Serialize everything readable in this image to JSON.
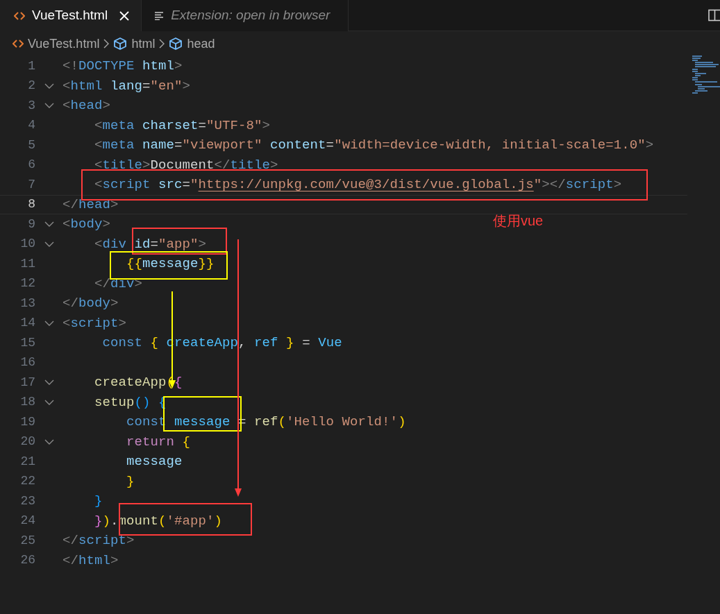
{
  "tabs": [
    {
      "label": "VueTest.html",
      "selected": true,
      "kind": "file"
    },
    {
      "label": "Extension: open in browser",
      "selected": false,
      "kind": "preview"
    }
  ],
  "breadcrumbs": [
    {
      "label": "VueTest.html",
      "kind": "file"
    },
    {
      "label": "html",
      "kind": "element"
    },
    {
      "label": "head",
      "kind": "element"
    }
  ],
  "lines": [
    {
      "number": "1",
      "foldable": false,
      "current": false,
      "tokens": [
        {
          "kind": "punct",
          "text": "<!"
        },
        {
          "kind": "tag",
          "text": "DOCTYPE"
        },
        {
          "kind": "attr",
          "text": " html"
        },
        {
          "kind": "punct",
          "text": ">"
        }
      ]
    },
    {
      "number": "2",
      "foldable": true,
      "current": false,
      "tokens": [
        {
          "kind": "punct",
          "text": "<"
        },
        {
          "kind": "tag",
          "text": "html"
        },
        {
          "kind": "attr",
          "text": " lang"
        },
        {
          "kind": "plain",
          "text": "="
        },
        {
          "kind": "string",
          "text": "\"en\""
        },
        {
          "kind": "punct",
          "text": ">"
        }
      ]
    },
    {
      "number": "3",
      "foldable": true,
      "current": false,
      "tokens": [
        {
          "kind": "punct",
          "text": "<"
        },
        {
          "kind": "tag",
          "text": "head"
        },
        {
          "kind": "punct",
          "text": ">"
        }
      ]
    },
    {
      "number": "4",
      "foldable": false,
      "current": false,
      "tokens": [
        {
          "kind": "punct",
          "text": "    <"
        },
        {
          "kind": "tag",
          "text": "meta"
        },
        {
          "kind": "attr",
          "text": " charset"
        },
        {
          "kind": "plain",
          "text": "="
        },
        {
          "kind": "string",
          "text": "\"UTF-8\""
        },
        {
          "kind": "punct",
          "text": ">"
        }
      ]
    },
    {
      "number": "5",
      "foldable": false,
      "current": false,
      "tokens": [
        {
          "kind": "punct",
          "text": "    <"
        },
        {
          "kind": "tag",
          "text": "meta"
        },
        {
          "kind": "attr",
          "text": " name"
        },
        {
          "kind": "plain",
          "text": "="
        },
        {
          "kind": "string",
          "text": "\"viewport\""
        },
        {
          "kind": "attr",
          "text": " content"
        },
        {
          "kind": "plain",
          "text": "="
        },
        {
          "kind": "string",
          "text": "\"width=device-width, initial-scale=1.0\""
        },
        {
          "kind": "punct",
          "text": ">"
        }
      ]
    },
    {
      "number": "6",
      "foldable": false,
      "current": false,
      "tokens": [
        {
          "kind": "punct",
          "text": "    <"
        },
        {
          "kind": "tag",
          "text": "title"
        },
        {
          "kind": "punct",
          "text": ">"
        },
        {
          "kind": "plain",
          "text": "Document"
        },
        {
          "kind": "punct",
          "text": "</"
        },
        {
          "kind": "tag",
          "text": "title"
        },
        {
          "kind": "punct",
          "text": ">"
        }
      ]
    },
    {
      "number": "7",
      "foldable": false,
      "current": false,
      "tokens": [
        {
          "kind": "punct",
          "text": "    <"
        },
        {
          "kind": "tag",
          "text": "script"
        },
        {
          "kind": "attr",
          "text": " src"
        },
        {
          "kind": "plain",
          "text": "="
        },
        {
          "kind": "string",
          "text": "\""
        },
        {
          "kind": "url",
          "text": "https://unpkg.com/vue@3/dist/vue.global.js"
        },
        {
          "kind": "string",
          "text": "\""
        },
        {
          "kind": "punct",
          "text": "></"
        },
        {
          "kind": "tag",
          "text": "script"
        },
        {
          "kind": "punct",
          "text": ">"
        }
      ]
    },
    {
      "number": "8",
      "foldable": false,
      "current": true,
      "tokens": [
        {
          "kind": "punct",
          "text": "</"
        },
        {
          "kind": "tag",
          "text": "head"
        },
        {
          "kind": "punct",
          "text": ">"
        }
      ]
    },
    {
      "number": "9",
      "foldable": true,
      "current": false,
      "tokens": [
        {
          "kind": "punct",
          "text": "<"
        },
        {
          "kind": "tag",
          "text": "body"
        },
        {
          "kind": "punct",
          "text": ">"
        }
      ]
    },
    {
      "number": "10",
      "foldable": true,
      "current": false,
      "tokens": [
        {
          "kind": "punct",
          "text": "    <"
        },
        {
          "kind": "tag",
          "text": "div"
        },
        {
          "kind": "attr",
          "text": " id"
        },
        {
          "kind": "plain",
          "text": "="
        },
        {
          "kind": "string",
          "text": "\"app\""
        },
        {
          "kind": "punct",
          "text": ">"
        }
      ]
    },
    {
      "number": "11",
      "foldable": false,
      "current": false,
      "tokens": [
        {
          "kind": "gold",
          "text": "        {{"
        },
        {
          "kind": "attr",
          "text": "message"
        },
        {
          "kind": "gold",
          "text": "}}"
        }
      ]
    },
    {
      "number": "12",
      "foldable": false,
      "current": false,
      "tokens": [
        {
          "kind": "punct",
          "text": "    </"
        },
        {
          "kind": "tag",
          "text": "div"
        },
        {
          "kind": "punct",
          "text": ">"
        }
      ]
    },
    {
      "number": "13",
      "foldable": false,
      "current": false,
      "tokens": [
        {
          "kind": "punct",
          "text": "</"
        },
        {
          "kind": "tag",
          "text": "body"
        },
        {
          "kind": "punct",
          "text": ">"
        }
      ]
    },
    {
      "number": "14",
      "foldable": true,
      "current": false,
      "tokens": [
        {
          "kind": "punct",
          "text": "<"
        },
        {
          "kind": "tag",
          "text": "script"
        },
        {
          "kind": "punct",
          "text": ">"
        }
      ]
    },
    {
      "number": "15",
      "foldable": false,
      "current": false,
      "tokens": [
        {
          "kind": "tag",
          "text": "     const"
        },
        {
          "kind": "gold",
          "text": " {"
        },
        {
          "kind": "constant",
          "text": " createApp"
        },
        {
          "kind": "plain",
          "text": ","
        },
        {
          "kind": "constant",
          "text": " ref"
        },
        {
          "kind": "gold",
          "text": " }"
        },
        {
          "kind": "plain",
          "text": " ="
        },
        {
          "kind": "constant",
          "text": " Vue"
        }
      ]
    },
    {
      "number": "16",
      "foldable": false,
      "current": false
    },
    {
      "number": "17",
      "foldable": true,
      "current": false,
      "tokens": [
        {
          "kind": "function",
          "text": "    createApp"
        },
        {
          "kind": "gold",
          "text": "("
        },
        {
          "kind": "pink",
          "text": "{"
        }
      ]
    },
    {
      "number": "18",
      "foldable": true,
      "current": false,
      "tokens": [
        {
          "kind": "function",
          "text": "    setup"
        },
        {
          "kind": "blue",
          "text": "()"
        },
        {
          "kind": "blue",
          "text": " {"
        }
      ]
    },
    {
      "number": "19",
      "foldable": false,
      "current": false,
      "tokens": [
        {
          "kind": "tag",
          "text": "        const"
        },
        {
          "kind": "constant",
          "text": " message"
        },
        {
          "kind": "plain",
          "text": " ="
        },
        {
          "kind": "function",
          "text": " ref"
        },
        {
          "kind": "gold",
          "text": "("
        },
        {
          "kind": "string",
          "text": "'Hello World!'"
        },
        {
          "kind": "gold",
          "text": ")"
        }
      ]
    },
    {
      "number": "20",
      "foldable": true,
      "current": false,
      "tokens": [
        {
          "kind": "control",
          "text": "        return"
        },
        {
          "kind": "gold",
          "text": " {"
        }
      ]
    },
    {
      "number": "21",
      "foldable": false,
      "current": false,
      "tokens": [
        {
          "kind": "attr",
          "text": "        message"
        }
      ]
    },
    {
      "number": "22",
      "foldable": false,
      "current": false,
      "tokens": [
        {
          "kind": "gold",
          "text": "        }"
        }
      ]
    },
    {
      "number": "23",
      "foldable": false,
      "current": false,
      "tokens": [
        {
          "kind": "blue",
          "text": "    }"
        }
      ]
    },
    {
      "number": "24",
      "foldable": false,
      "current": false,
      "tokens": [
        {
          "kind": "pink",
          "text": "    }"
        },
        {
          "kind": "gold",
          "text": ")"
        },
        {
          "kind": "plain",
          "text": "."
        },
        {
          "kind": "function",
          "text": "mount"
        },
        {
          "kind": "gold",
          "text": "("
        },
        {
          "kind": "string",
          "text": "'#app'"
        },
        {
          "kind": "gold",
          "text": ")"
        }
      ]
    },
    {
      "number": "25",
      "foldable": false,
      "current": false,
      "tokens": [
        {
          "kind": "punct",
          "text": "</"
        },
        {
          "kind": "tag",
          "text": "script"
        },
        {
          "kind": "punct",
          "text": ">"
        }
      ]
    },
    {
      "number": "26",
      "foldable": false,
      "current": false,
      "tokens": [
        {
          "kind": "punct",
          "text": "</"
        },
        {
          "kind": "tag",
          "text": "html"
        },
        {
          "kind": "punct",
          "text": ">"
        }
      ]
    }
  ],
  "annotations": [
    {
      "kind": "box",
      "color": "#ff3b3b"
    },
    {
      "kind": "box",
      "color": "#ff3b3b"
    },
    {
      "kind": "box",
      "color": "#ffff00"
    },
    {
      "kind": "box",
      "color": "#ffff00"
    },
    {
      "kind": "box",
      "color": "#ff3b3b"
    },
    {
      "kind": "arrow",
      "color": "#ffff00"
    },
    {
      "kind": "arrow",
      "color": "#ff3b3b"
    },
    {
      "kind": "label",
      "color": "#ff3b3b",
      "text": "使用vue"
    }
  ]
}
